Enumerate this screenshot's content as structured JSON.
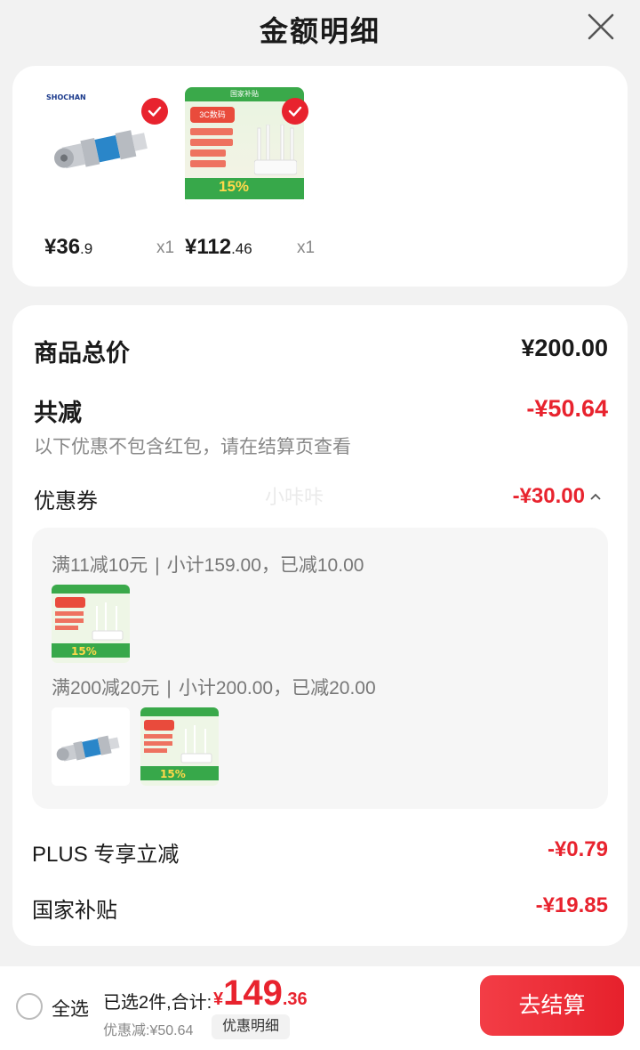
{
  "header": {
    "title": "金额明细"
  },
  "products": [
    {
      "brand": "SHOCHAN",
      "price_int": "¥36",
      "price_dec": ".9",
      "qty": "x1",
      "selected": true
    },
    {
      "brand": "国家补贴",
      "price_int": "¥112",
      "price_dec": ".46",
      "qty": "x1",
      "selected": true,
      "thumb_tag": "3C数码",
      "thumb_badge": "NFC",
      "thumb_percent": "15%"
    }
  ],
  "details": {
    "total_label": "商品总价",
    "total_value": "¥200.00",
    "reduce_label": "共减",
    "reduce_value": "-¥50.64",
    "note": "以下优惠不包含红包，请在结算页查看",
    "coupon_label": "优惠券",
    "coupon_value": "-¥30.00",
    "watermark": "小咔咔",
    "rules": [
      {
        "title": "满11减10元",
        "subtotal": "小计159.00，已减10.00"
      },
      {
        "title": "满200减20元",
        "subtotal": "小计200.00，已减20.00"
      }
    ],
    "plus_label": "PLUS 专享立减",
    "plus_value": "-¥0.79",
    "gov_label": "国家补贴",
    "gov_value": "-¥19.85"
  },
  "bottom": {
    "select_all": "全选",
    "summary": "已选2件,合计:",
    "total_yen": "¥",
    "total_int": "149",
    "total_dec": ".36",
    "discount": "优惠减:¥50.64",
    "detail_chip": "优惠明细",
    "checkout": "去结算"
  },
  "colors": {
    "accent": "#e8232e",
    "background": "#f2f2f2",
    "green": "#3aa94a"
  }
}
